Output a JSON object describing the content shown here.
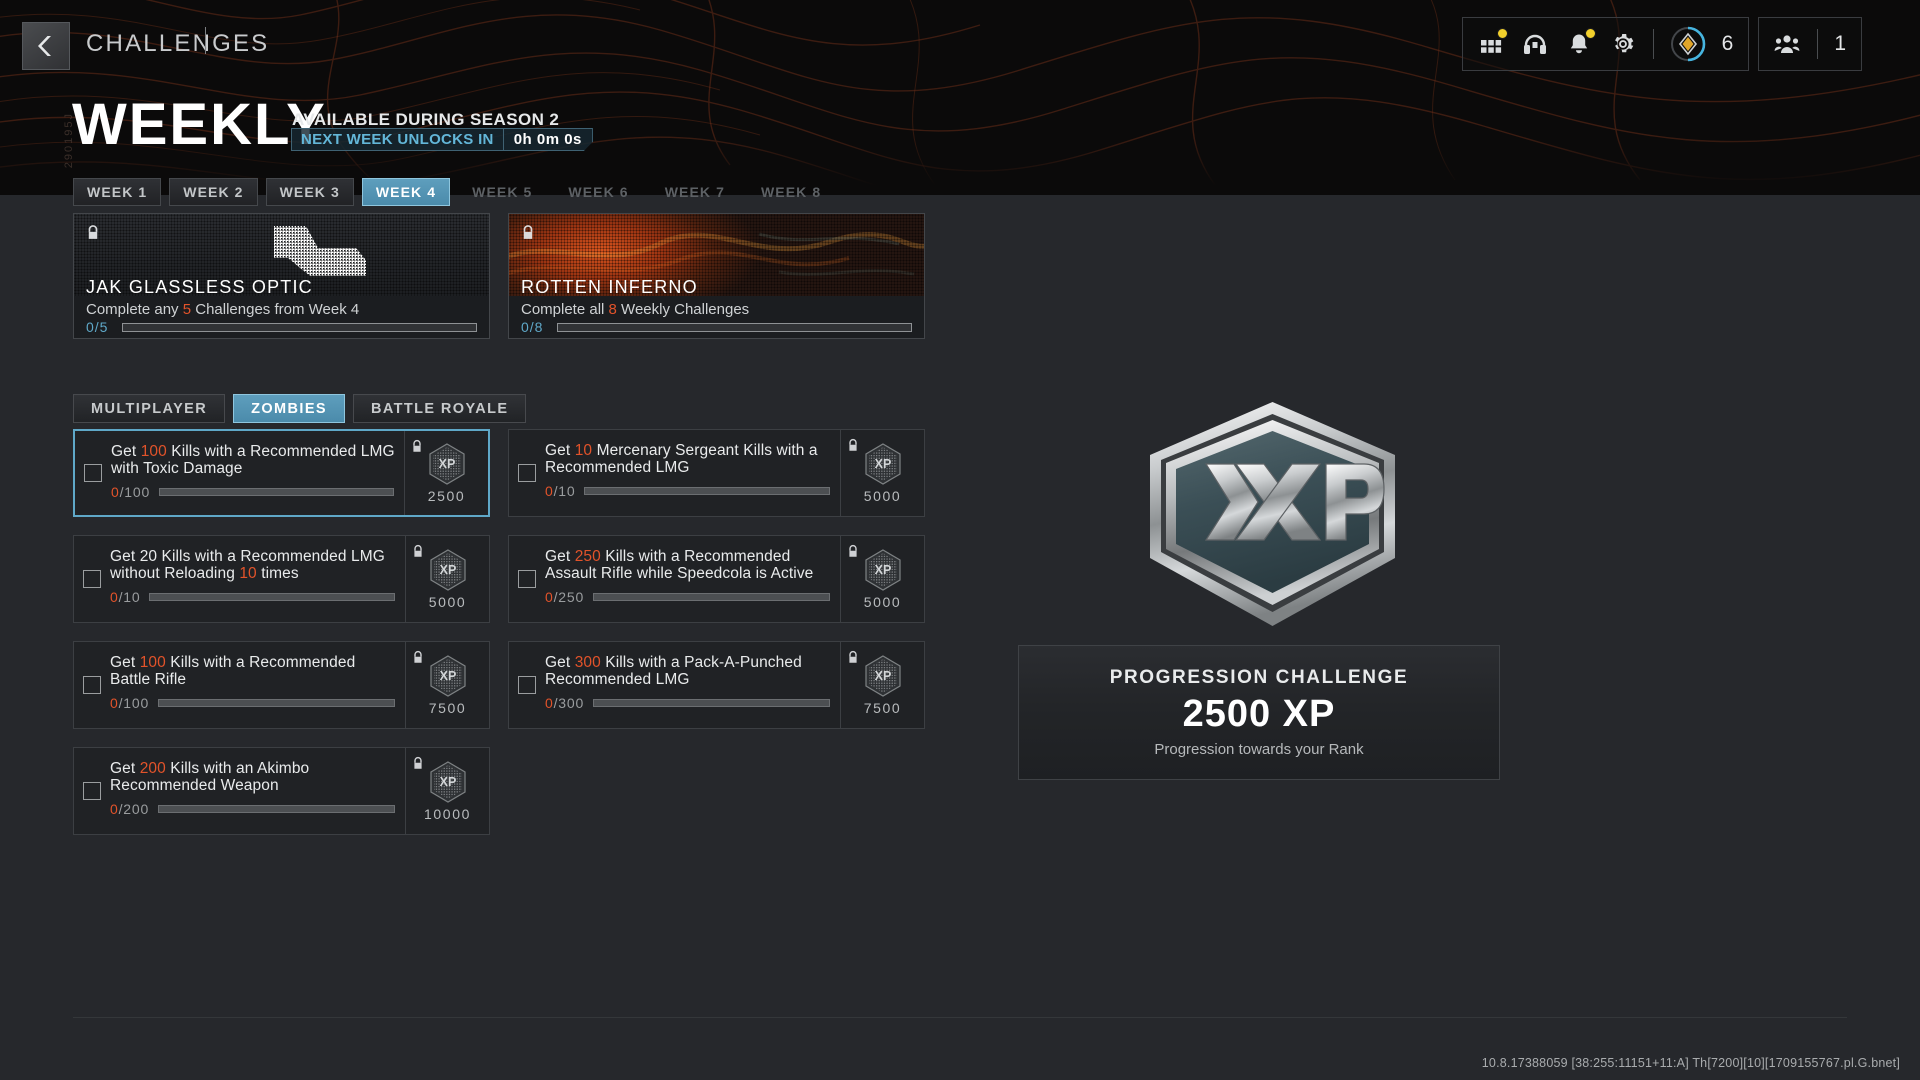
{
  "header": {
    "breadcrumb": "CHALLENGES",
    "back_icon": "chevron-left-icon",
    "hud": {
      "icons": [
        {
          "name": "grid-apps-icon",
          "badge": true
        },
        {
          "name": "headphones-icon",
          "badge": false
        },
        {
          "name": "bell-notifications-icon",
          "badge": true
        },
        {
          "name": "gear-settings-icon",
          "badge": false
        }
      ],
      "battlepass": {
        "icon": "diamond-rank-icon",
        "value": "6"
      },
      "party": {
        "icon": "squad-party-icon",
        "value": "1"
      }
    }
  },
  "page": {
    "side_code": "290195J",
    "title": "WEEKLY",
    "availability": "AVAILABLE DURING SEASON 2",
    "timer_label": "NEXT WEEK UNLOCKS IN",
    "timer_value": "0h 0m 0s"
  },
  "week_tabs": [
    {
      "label": "WEEK 1",
      "state": "normal"
    },
    {
      "label": "WEEK 2",
      "state": "normal"
    },
    {
      "label": "WEEK 3",
      "state": "normal"
    },
    {
      "label": "WEEK 4",
      "state": "active"
    },
    {
      "label": "WEEK 5",
      "state": "locked"
    },
    {
      "label": "WEEK 6",
      "state": "locked"
    },
    {
      "label": "WEEK 7",
      "state": "locked"
    },
    {
      "label": "WEEK 8",
      "state": "locked"
    }
  ],
  "rewards": [
    {
      "name": "JAK GLASSLESS OPTIC",
      "desc_pre": "Complete any ",
      "desc_hl": "5",
      "desc_post": " Challenges from Week 4",
      "progress_text": "0/5",
      "current": 0,
      "target": 5,
      "locked": true,
      "art": "weapon-attachment-silhouette"
    },
    {
      "name": "ROTTEN INFERNO",
      "desc_pre": "Complete all ",
      "desc_hl": "8",
      "desc_post": " Weekly Challenges",
      "progress_text": "0/8",
      "current": 0,
      "target": 8,
      "locked": true,
      "art": "rotten-inferno-camo"
    }
  ],
  "mode_tabs": [
    {
      "label": "MULTIPLAYER",
      "state": "normal"
    },
    {
      "label": "ZOMBIES",
      "state": "active"
    },
    {
      "label": "BATTLE ROYALE",
      "state": "normal"
    }
  ],
  "challenges": [
    {
      "text_pre": "Get ",
      "text_hl": "100",
      "text_post": " Kills with a Recommended LMG with Toxic Damage",
      "current": "0",
      "total": "/100",
      "xp": "2500",
      "locked": true,
      "selected": true,
      "checked": false
    },
    {
      "text_pre": "Get ",
      "text_hl": "10",
      "text_post": " Mercenary Sergeant Kills with a Recommended LMG",
      "current": "0",
      "total": "/10",
      "xp": "5000",
      "locked": true,
      "selected": false,
      "checked": false
    },
    {
      "text_pre": "Get 20 Kills with a Recommended LMG without Reloading ",
      "text_hl": "10",
      "text_post": " times",
      "current": "0",
      "total": "/10",
      "xp": "5000",
      "locked": true,
      "selected": false,
      "checked": false
    },
    {
      "text_pre": "Get ",
      "text_hl": "250",
      "text_post": " Kills with a Recommended Assault Rifle while Speedcola is Active",
      "current": "0",
      "total": "/250",
      "xp": "5000",
      "locked": true,
      "selected": false,
      "checked": false
    },
    {
      "text_pre": "Get ",
      "text_hl": "100",
      "text_post": " Kills with a Recommended Battle Rifle",
      "current": "0",
      "total": "/100",
      "xp": "7500",
      "locked": true,
      "selected": false,
      "checked": false
    },
    {
      "text_pre": "Get ",
      "text_hl": "300",
      "text_post": " Kills with a Pack-A-Punched Recommended LMG",
      "current": "0",
      "total": "/300",
      "xp": "7500",
      "locked": true,
      "selected": false,
      "checked": false
    },
    {
      "text_pre": "Get ",
      "text_hl": "200",
      "text_post": " Kills with an Akimbo Recommended Weapon",
      "current": "0",
      "total": "/200",
      "xp": "10000",
      "locked": true,
      "selected": false,
      "checked": false
    }
  ],
  "detail_panel": {
    "badge_label": "XP",
    "title": "PROGRESSION CHALLENGE",
    "amount": "2500 XP",
    "subtitle": "Progression towards your Rank"
  },
  "footer": {
    "build": "10.8.17388059 [38:255:11151+11:A] Th[7200][10][1709155767.pl.G.bnet]"
  },
  "colors": {
    "accent_blue": "#5fa8c8",
    "accent_orange": "#e2532a",
    "badge_yellow": "#f2d02c",
    "bg": "#26282c"
  }
}
